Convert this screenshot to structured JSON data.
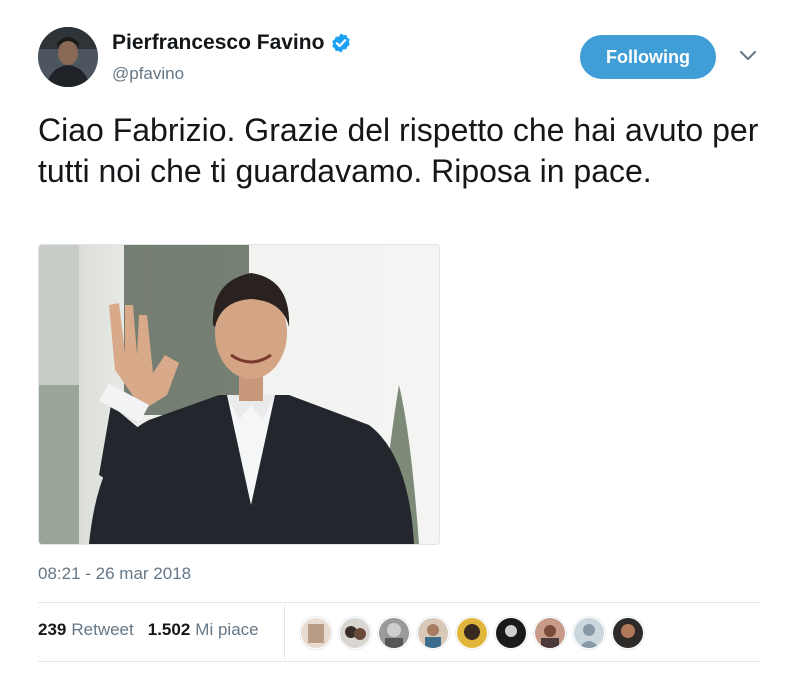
{
  "user": {
    "name": "Pierfrancesco Favino",
    "handle": "@pfavino",
    "verified": true
  },
  "follow_button": {
    "label": "Following",
    "color": "#3f9ed6"
  },
  "tweet": {
    "text": "Ciao Fabrizio. Grazie del rispetto che hai avuto per tutti noi che ti guardavamo. Riposa in pace.",
    "timestamp": "08:21 - 26 mar 2018"
  },
  "stats": {
    "retweets": "239",
    "retweets_label": "Retweet",
    "likes": "1.502",
    "likes_label": "Mi piace"
  },
  "icons": {
    "verified": "verified-badge-icon",
    "menu": "chevron-down-icon"
  },
  "colors": {
    "accent": "#1da1f2",
    "muted_text": "#657786",
    "divider": "#e1e8ed"
  }
}
